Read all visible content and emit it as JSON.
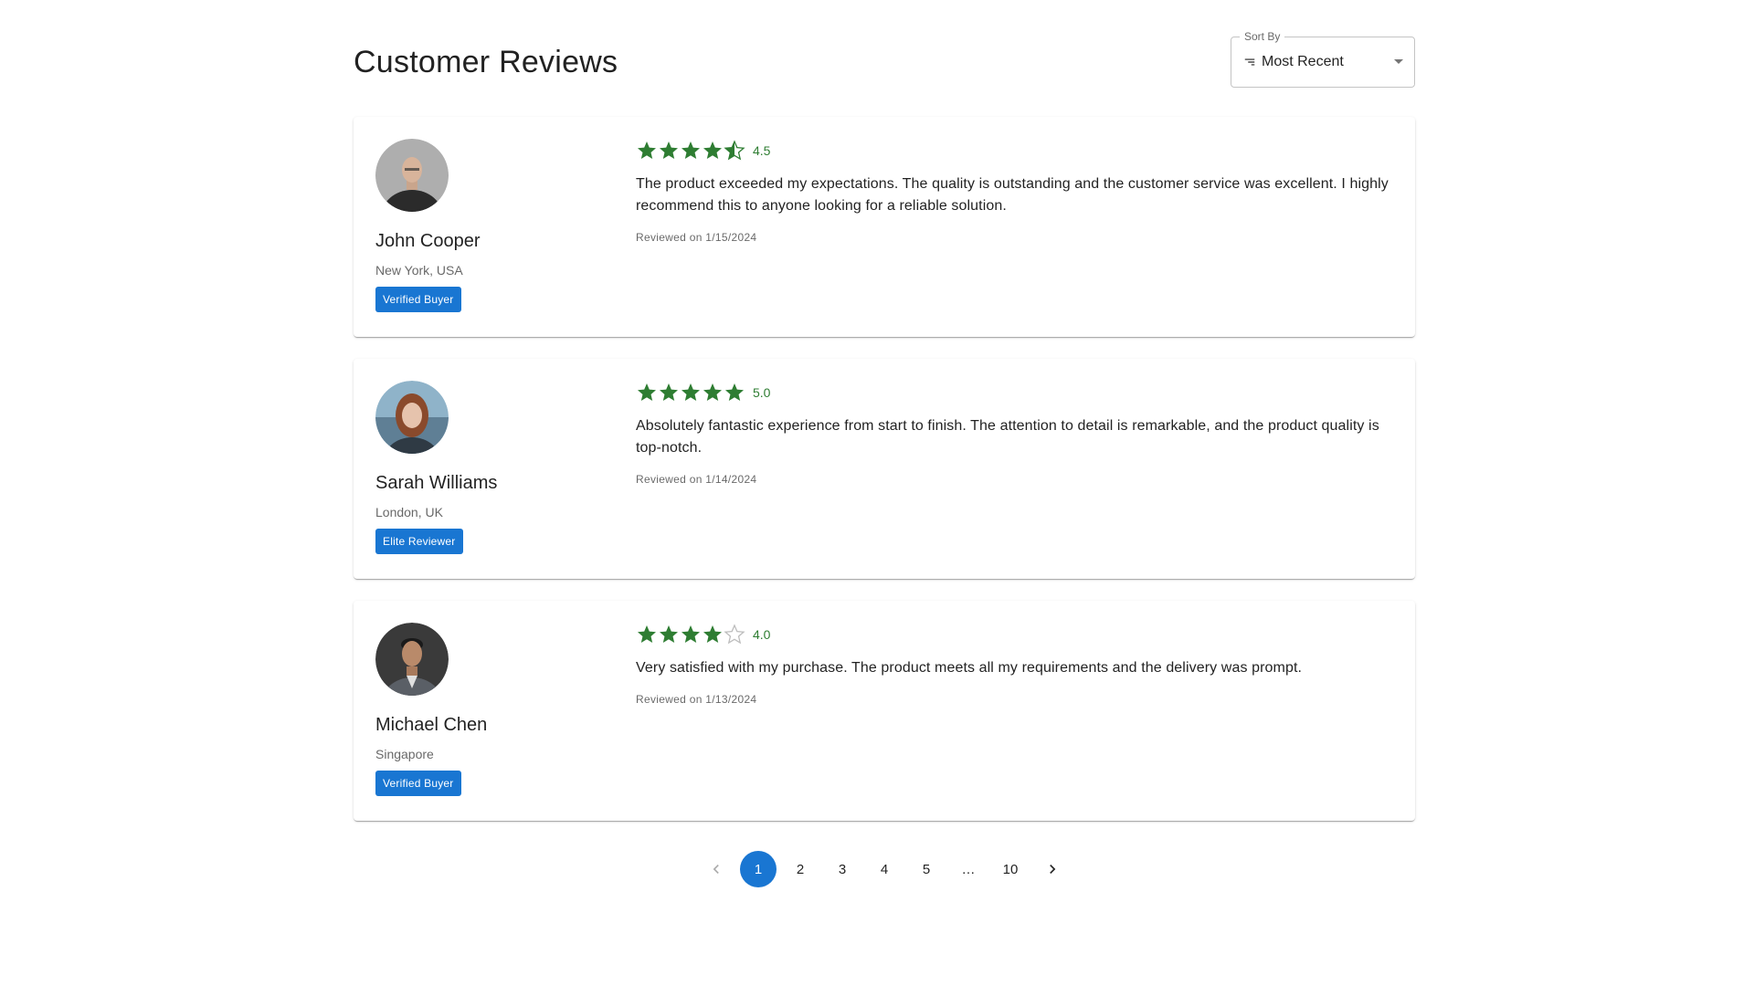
{
  "page": {
    "title": "Customer Reviews"
  },
  "sort": {
    "label": "Sort By",
    "selected": "Most Recent",
    "icon": "sort-icon"
  },
  "colors": {
    "primary": "#1976d2",
    "star": "#2e7d32",
    "star_empty": "#bdbdbd"
  },
  "reviews": [
    {
      "name": "John Cooper",
      "location": "New York, USA",
      "badge": "Verified Buyer",
      "rating": 4.5,
      "rating_label": "4.5",
      "text": "The product exceeded my expectations. The quality is outstanding and the customer service was excellent. I highly recommend this to anyone looking for a reliable solution.",
      "date": "Reviewed on 1/15/2024"
    },
    {
      "name": "Sarah Williams",
      "location": "London, UK",
      "badge": "Elite Reviewer",
      "rating": 5.0,
      "rating_label": "5.0",
      "text": "Absolutely fantastic experience from start to finish. The attention to detail is remarkable, and the product quality is top-notch.",
      "date": "Reviewed on 1/14/2024"
    },
    {
      "name": "Michael Chen",
      "location": "Singapore",
      "badge": "Verified Buyer",
      "rating": 4.0,
      "rating_label": "4.0",
      "text": "Very satisfied with my purchase. The product meets all my requirements and the delivery was prompt.",
      "date": "Reviewed on 1/13/2024"
    }
  ],
  "pagination": {
    "pages": [
      "1",
      "2",
      "3",
      "4",
      "5"
    ],
    "ellipsis": "…",
    "last": "10",
    "current": "1"
  }
}
